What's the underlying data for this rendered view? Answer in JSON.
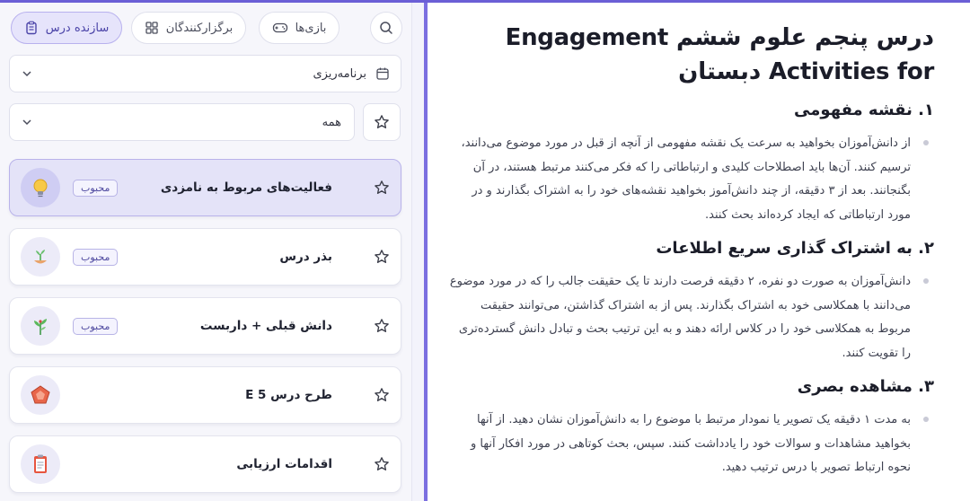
{
  "content": {
    "title": "درس پنجم علوم ششم Engagement Activities for دبستان",
    "sections": [
      {
        "heading": "۱. نقشه مفهومی",
        "text": "از دانش‌آموزان بخواهید به سرعت یک نقشه مفهومی از آنچه از قبل در مورد موضوع می‌دانند، ترسیم کنند. آن‌ها باید اصطلاحات کلیدی و ارتباطاتی را که فکر می‌کنند مرتبط هستند، در آن بگنجانند. بعد از ۳ دقیقه، از چند دانش‌آموز بخواهید نقشه‌های خود را به اشتراک بگذارند و در مورد ارتباطاتی که ایجاد کرده‌اند بحث کنند."
      },
      {
        "heading": "۲. به اشتراک گذاری سریع اطلاعات",
        "text": "دانش‌آموزان به صورت دو نفره، ۲ دقیقه فرصت دارند تا یک حقیقت جالب را که در مورد موضوع می‌دانند با همکلاسی خود به اشتراک بگذارند. پس از به اشتراک گذاشتن، می‌توانند حقیقت مربوط به همکلاسی خود را در کلاس ارائه دهند و به این ترتیب بحث و تبادل دانش گسترده‌تری را تقویت کنند."
      },
      {
        "heading": "۳. مشاهده بصری",
        "text": "به مدت ۱ دقیقه یک تصویر یا نمودار مرتبط با موضوع را به دانش‌آموزان نشان دهید. از آنها بخواهید مشاهدات و سوالات خود را یادداشت کنند. سپس، بحث کوتاهی در مورد افکار آنها و نحوه ارتباط تصویر با درس ترتیب دهید."
      }
    ]
  },
  "sidebar": {
    "tabs": {
      "lesson_builder": "سازنده درس",
      "organizers": "برگزارکنندگان",
      "games": "بازی‌ها"
    },
    "planning_select": "برنامه‌ریزی",
    "filter_select": "همه",
    "badge_label": "محبوب",
    "items": [
      {
        "title": "فعالیت‌های مربوط به نامزدی",
        "badge": "محبوب",
        "icon": "lightbulb-icon"
      },
      {
        "title": "بذر درس",
        "badge": "محبوب",
        "icon": "seedling-icon"
      },
      {
        "title": "دانش قبلی + داربست",
        "badge": "محبوب",
        "icon": "plant-icon"
      },
      {
        "title": "طرح درس 5 E",
        "badge": "",
        "icon": "pentagon-icon"
      },
      {
        "title": "اقدامات ارزیابی",
        "badge": "",
        "icon": "clipboard-icon"
      }
    ]
  },
  "colors": {
    "accent": "#6b5fd6",
    "selected_card": "#e4e3f8",
    "badge_text": "#4f4aa0"
  }
}
